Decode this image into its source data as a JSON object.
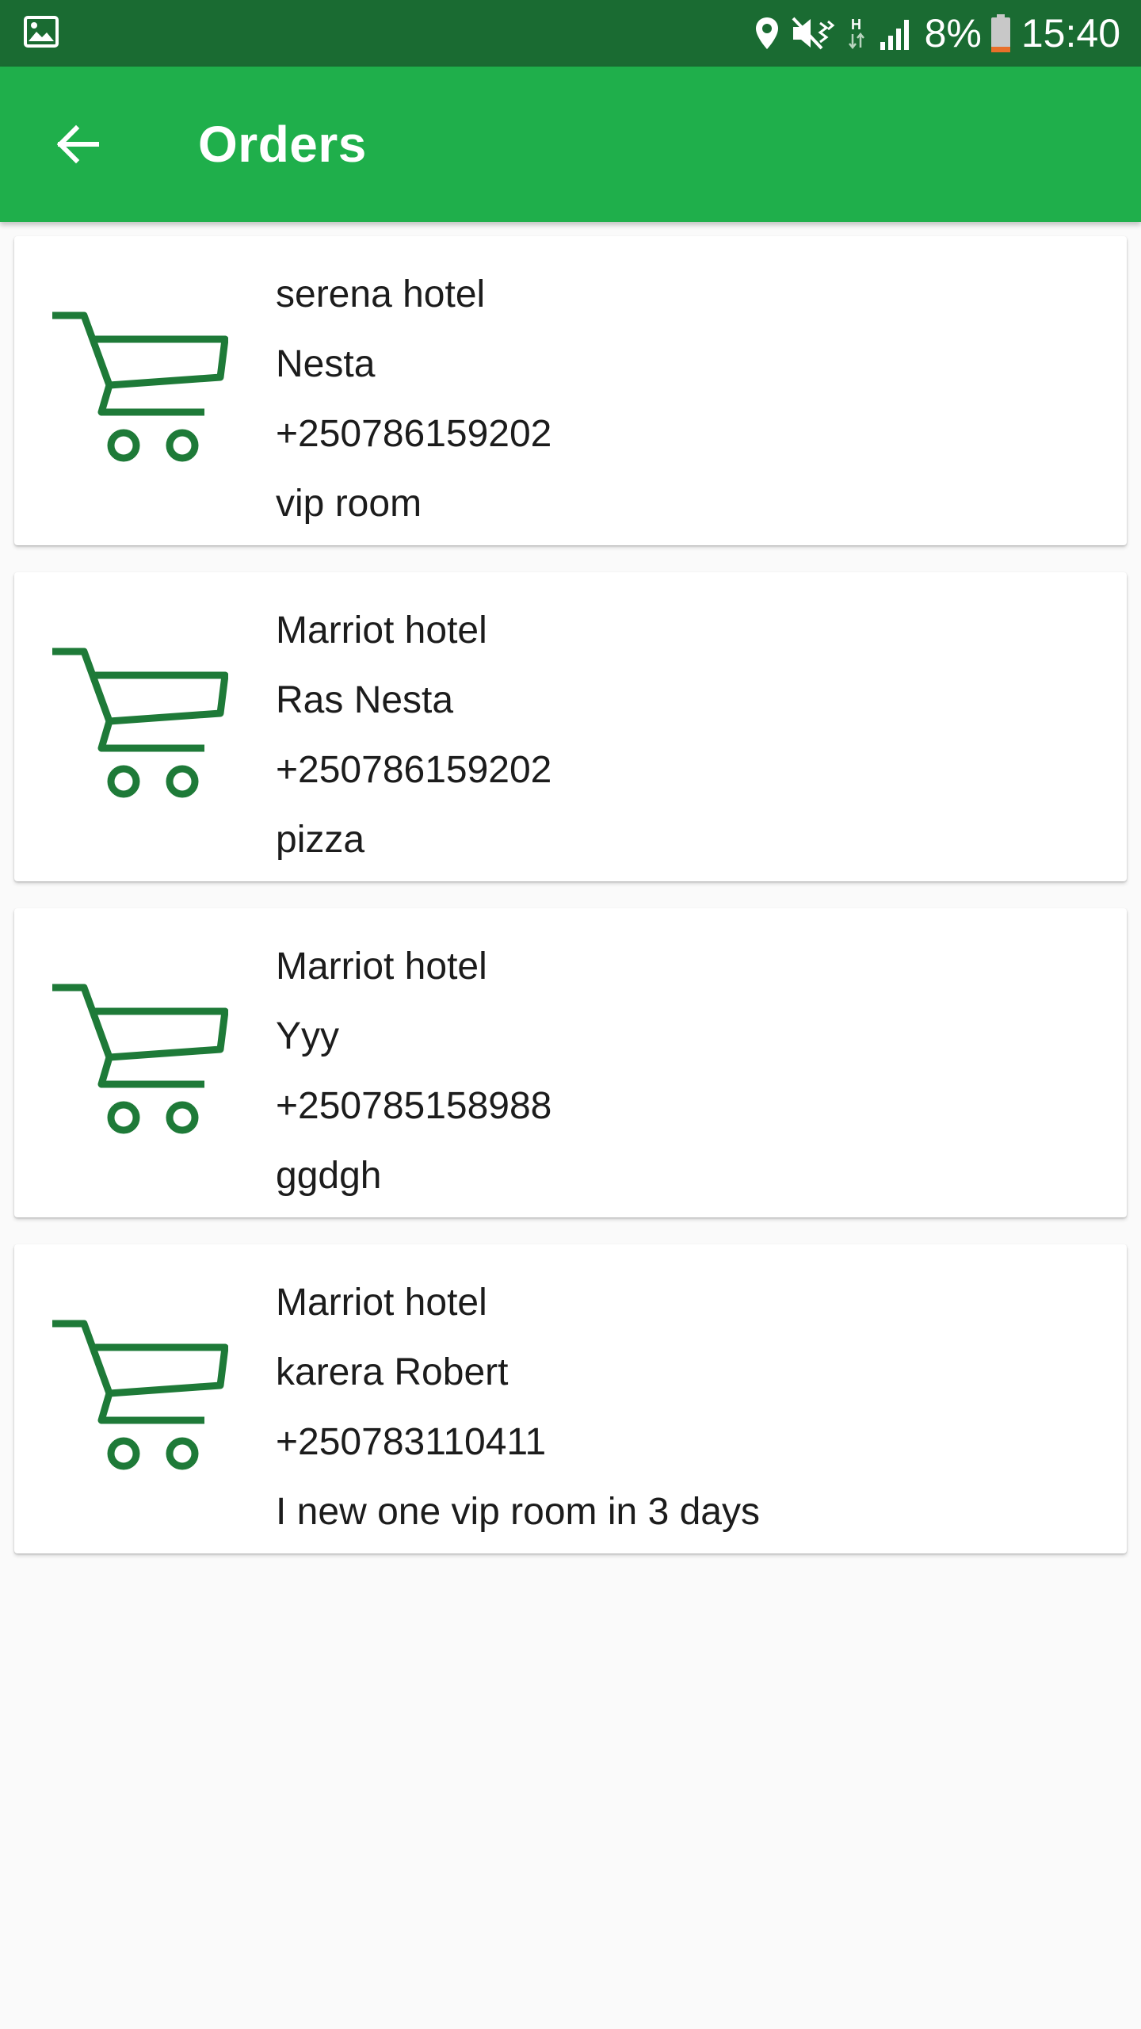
{
  "status_bar": {
    "battery": "8%",
    "time": "15:40",
    "icons": [
      "gallery-icon",
      "location-icon",
      "mute-vibrate-icon",
      "h-data-icon",
      "signal-icon",
      "battery-icon"
    ],
    "battery_color": "#e8702a"
  },
  "app_bar": {
    "title": "Orders",
    "back_icon": "arrow-left-icon",
    "color": "#1faf4b"
  },
  "orders": [
    {
      "hotel": "serena hotel",
      "name": "Nesta",
      "phone": "+250786159202",
      "description": "vip room"
    },
    {
      "hotel": "Marriot hotel",
      "name": "Ras Nesta",
      "phone": "+250786159202",
      "description": "pizza"
    },
    {
      "hotel": "Marriot hotel",
      "name": "Yyy",
      "phone": "+250785158988",
      "description": "ggdgh"
    },
    {
      "hotel": "Marriot hotel",
      "name": "karera Robert",
      "phone": "+250783110411",
      "description": "I new one vip room in 3 days"
    }
  ],
  "theme": {
    "status_bar": "#1a6b32",
    "accent": "#1faf4b",
    "cart_icon": "#1e7a38"
  }
}
